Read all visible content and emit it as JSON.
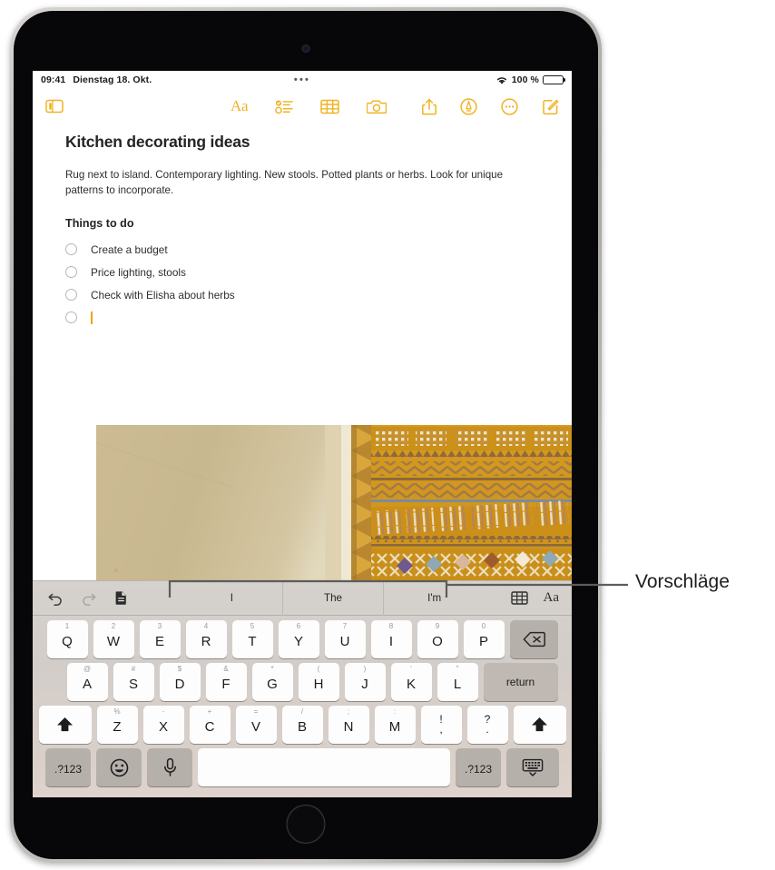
{
  "status_bar": {
    "time": "09:41",
    "date": "Dienstag 18. Okt.",
    "center_dots": "•••",
    "battery_percent": "100 %",
    "wifi_icon": "wifi-icon",
    "battery_icon": "battery-full-icon"
  },
  "toolbar": {
    "sidebar_icon": "sidebar-toggle-icon",
    "format_label": "Aa",
    "checklist_icon": "checklist-icon",
    "table_icon": "table-icon",
    "camera_icon": "camera-icon",
    "share_icon": "share-icon",
    "markup_icon": "markup-pen-icon",
    "more_icon": "more-ellipsis-icon",
    "compose_icon": "compose-note-icon",
    "accent_color": "#f0b323"
  },
  "note": {
    "title": "Kitchen decorating ideas",
    "paragraph": "Rug next to island. Contemporary lighting. New stools. Potted plants or herbs. Look for unique patterns to incorporate.",
    "subheading": "Things to do",
    "todos": [
      {
        "label": "Create a budget",
        "checked": false
      },
      {
        "label": "Price lighting, stools",
        "checked": false
      },
      {
        "label": "Check with Elisha about herbs",
        "checked": false
      },
      {
        "label": "",
        "checked": false,
        "cursor": true
      }
    ],
    "photo_alt": "woven rug with geometric patterns next to a plain wall"
  },
  "keyboard": {
    "suggestion_bar": {
      "undo_icon": "undo-arrow-icon",
      "redo_icon": "redo-arrow-icon",
      "paste_icon": "paste-clipboard-icon",
      "suggestions": [
        "I",
        "The",
        "I'm"
      ],
      "table_icon": "table-icon",
      "format_label": "Aa"
    },
    "rows": [
      {
        "name": "row-1",
        "keys": [
          {
            "main": "Q",
            "alt": "1"
          },
          {
            "main": "W",
            "alt": "2"
          },
          {
            "main": "E",
            "alt": "3"
          },
          {
            "main": "R",
            "alt": "4"
          },
          {
            "main": "T",
            "alt": "5"
          },
          {
            "main": "Y",
            "alt": "6"
          },
          {
            "main": "U",
            "alt": "7"
          },
          {
            "main": "I",
            "alt": "8"
          },
          {
            "main": "O",
            "alt": "9"
          },
          {
            "main": "P",
            "alt": "0"
          }
        ],
        "delete_key": "delete-backspace-icon"
      },
      {
        "name": "row-2",
        "keys": [
          {
            "main": "A",
            "alt": "@"
          },
          {
            "main": "S",
            "alt": "#"
          },
          {
            "main": "D",
            "alt": "$"
          },
          {
            "main": "F",
            "alt": "&"
          },
          {
            "main": "G",
            "alt": "*"
          },
          {
            "main": "H",
            "alt": "("
          },
          {
            "main": "J",
            "alt": ")"
          },
          {
            "main": "K",
            "alt": "'"
          },
          {
            "main": "L",
            "alt": "\""
          }
        ],
        "return_key": "return"
      },
      {
        "name": "row-3",
        "shift_left": "shift-up-arrow-icon",
        "keys": [
          {
            "main": "Z",
            "alt": "%"
          },
          {
            "main": "X",
            "alt": "-"
          },
          {
            "main": "C",
            "alt": "+"
          },
          {
            "main": "V",
            "alt": "="
          },
          {
            "main": "B",
            "alt": "/"
          },
          {
            "main": "N",
            "alt": ";"
          },
          {
            "main": "M",
            "alt": ":"
          }
        ],
        "punct_keys": [
          {
            "top": "!",
            "bot": ","
          },
          {
            "top": "?",
            "bot": "."
          }
        ],
        "shift_right": "shift-up-arrow-icon"
      },
      {
        "name": "row-4",
        "numeric_left": ".?123",
        "emoji_icon": "emoji-smiley-icon",
        "mic_icon": "microphone-icon",
        "space_label": "",
        "numeric_right": ".?123",
        "hide_keyboard_icon": "hide-keyboard-icon"
      }
    ]
  },
  "annotation": {
    "label": "Vorschläge"
  }
}
